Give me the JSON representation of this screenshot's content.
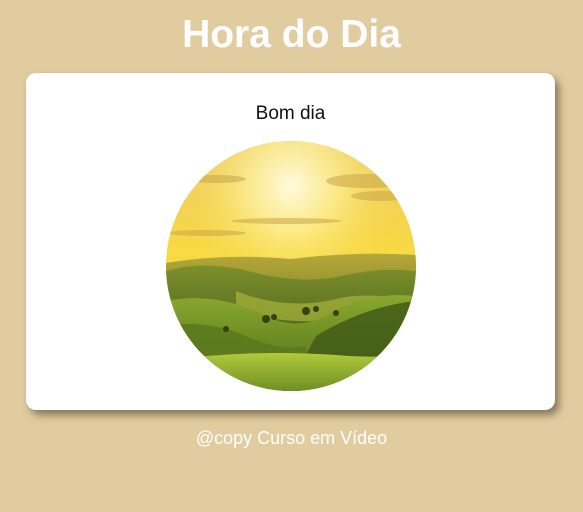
{
  "header": {
    "title": "Hora do Dia"
  },
  "card": {
    "greeting": "Bom dia",
    "image": {
      "icon": "morning-landscape-image"
    }
  },
  "footer": {
    "text": "@copy Curso em Vídeo"
  },
  "colors": {
    "background": "#e1cc9f",
    "card": "#ffffff",
    "title_text": "#ffffff",
    "footer_text": "#ffffff",
    "greeting_text": "#111111"
  }
}
